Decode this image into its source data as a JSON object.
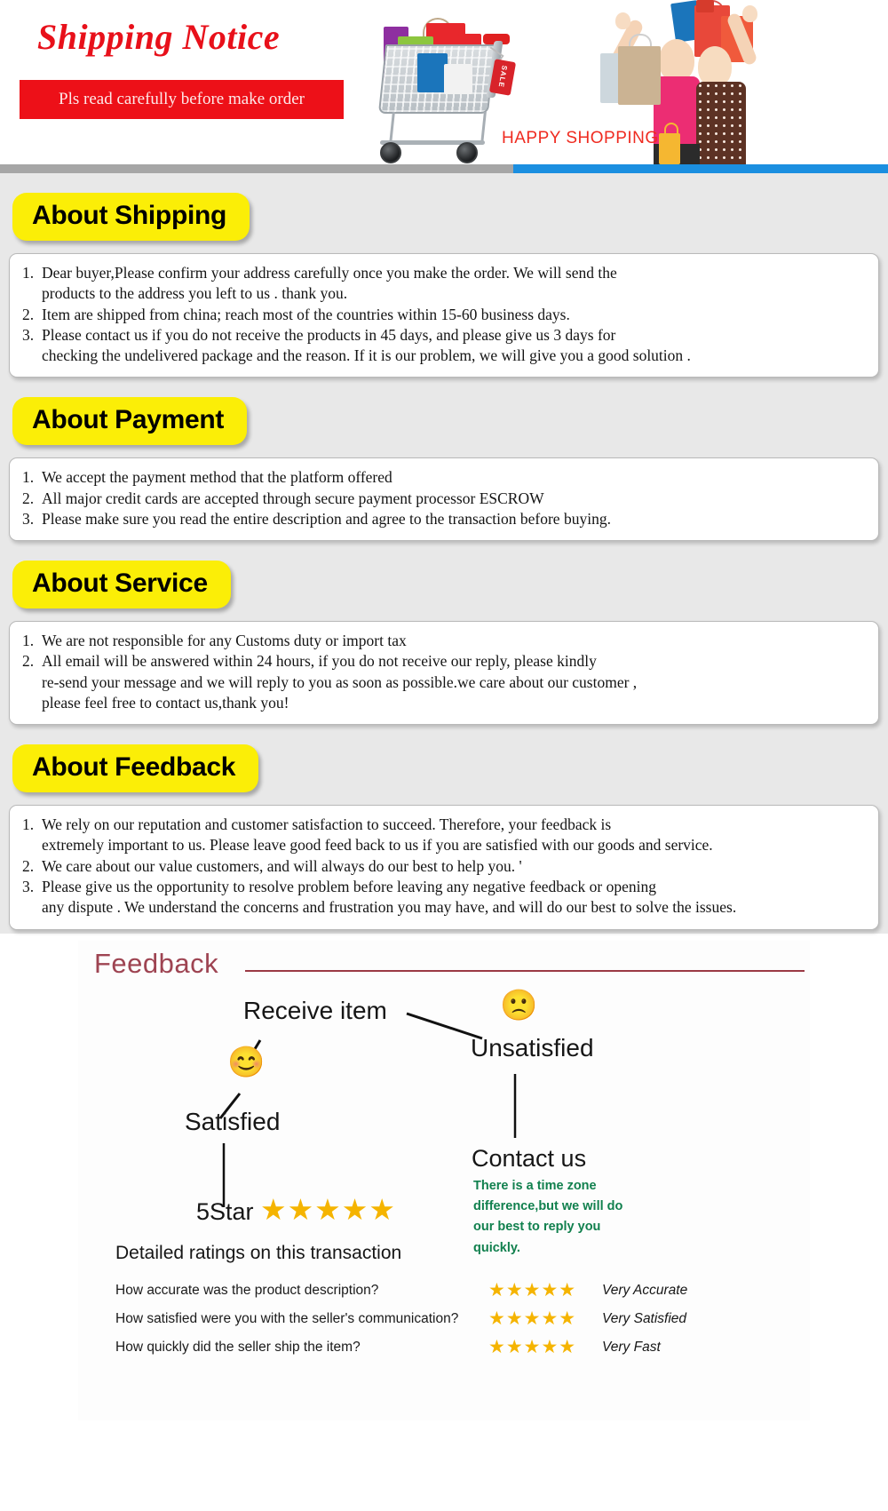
{
  "header": {
    "title": "Shipping Notice",
    "subtitle": "Pls read carefully before make order",
    "happy_shopping": "HAPPY SHOPPING",
    "sale_tag": "SALE",
    "title_color": "#e8101a",
    "bar_color": "#ed1018",
    "strip_grey": "#a6a6a6",
    "strip_blue": "#1b8fe0"
  },
  "sections": [
    {
      "badge": "About Shipping",
      "items": [
        {
          "num": "1.",
          "text": "Dear buyer,Please confirm your address carefully once you make the order. We will send the\n   products to the address you left to us . thank you."
        },
        {
          "num": "2.",
          "text": "Item are shipped from china; reach most of the countries within 15-60 business days."
        },
        {
          "num": "3.",
          "text": "Please contact us if you do not receive the products in 45 days, and please give us 3 days for\n   checking the undelivered package and the reason. If it is our problem, we will give you a good solution ."
        }
      ]
    },
    {
      "badge": "About Payment",
      "items": [
        {
          "num": "1.",
          "text": "We accept the payment method that the platform offered"
        },
        {
          "num": "2.",
          "text": "All major credit cards are accepted through secure payment processor ESCROW"
        },
        {
          "num": "3.",
          "text": "Please make sure you read the entire description and agree to the transaction before buying."
        }
      ]
    },
    {
      "badge": "About Service",
      "items": [
        {
          "num": "1.",
          "text": "We are not responsible for any Customs duty or import tax"
        },
        {
          "num": "2.",
          "text": "All email will be answered within 24 hours, if you do not receive our reply, please kindly\n  re-send your message and we will reply to you as soon as possible.we care about our customer ,\n  please feel free to contact us,thank you!"
        }
      ]
    },
    {
      "badge": "About Feedback",
      "items": [
        {
          "num": "1.",
          "text": "We rely on our reputation and customer satisfaction to succeed. Therefore, your feedback is\n   extremely important to us. Please leave good feed back to us if you are satisfied with our goods and service."
        },
        {
          "num": "2.",
          "text": "We care about our value customers, and will always do our best to help you. '"
        },
        {
          "num": "3.",
          "text": "Please give us the opportunity to resolve problem before leaving any negative feedback or opening\n   any dispute . We understand the concerns and frustration you may have, and will do our best to solve the issues."
        }
      ]
    }
  ],
  "feedback_diagram": {
    "title": "Feedback",
    "title_color": "#9e4452",
    "receive_item": "Receive item",
    "satisfied": "Satisfied",
    "unsatisfied": "Unsatisfied",
    "contact_us": "Contact us",
    "five_star": "5Star",
    "five_star_glyphs": "★★★★★",
    "timezone_note": "There is a time zone difference,but we will do our best to reply you quickly.",
    "timezone_note_color": "#11804e",
    "detailed_ratings_title": "Detailed ratings on this transaction",
    "satisfied_emoji": "😊",
    "unsatisfied_emoji": "🙁",
    "star_color": "#f5b400",
    "ratings": [
      {
        "question": "How accurate was the product description?",
        "stars": "★★★★★",
        "value": "Very Accurate"
      },
      {
        "question": "How satisfied were you with the seller's communication?",
        "stars": "★★★★★",
        "value": "Very Satisfied"
      },
      {
        "question": "How quickly did the seller ship the item?",
        "stars": "★★★★★",
        "value": "Very Fast"
      }
    ]
  }
}
